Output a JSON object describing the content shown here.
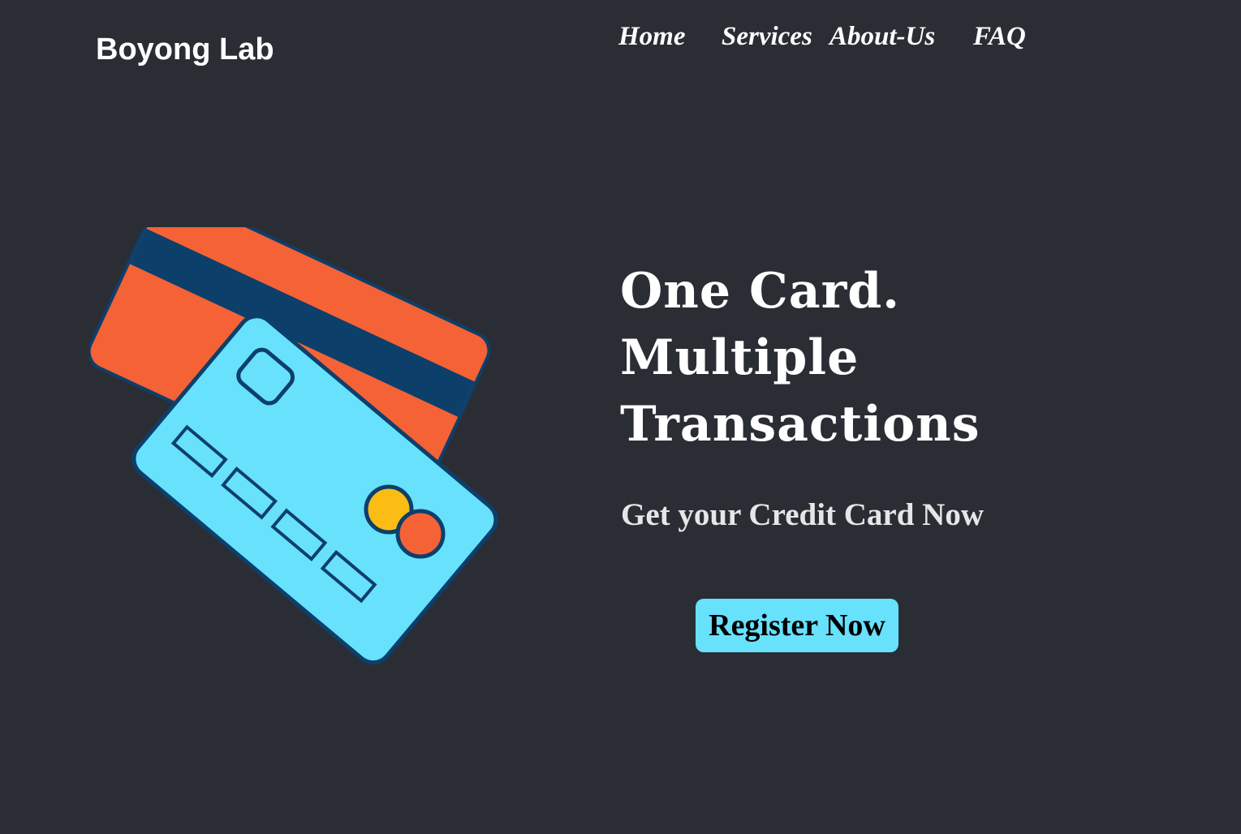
{
  "brand": {
    "name": "Boyong Lab"
  },
  "nav": {
    "items": [
      {
        "label": "Home"
      },
      {
        "label": "Services"
      },
      {
        "label": "About-Us"
      },
      {
        "label": "FAQ"
      }
    ]
  },
  "hero": {
    "headline": [
      "One Card.",
      "Multiple",
      "Transactions"
    ],
    "subheading": "Get your Credit Card Now",
    "cta_label": "Register Now",
    "illustration_icon": "credit-cards-icon"
  },
  "colors": {
    "background": "#2b2d35",
    "accent": "#67e1fc",
    "card_back": "#f46236",
    "card_stripe": "#0d3f6b",
    "card_front": "#67e1fc",
    "coin_yellow": "#fbbd14"
  }
}
